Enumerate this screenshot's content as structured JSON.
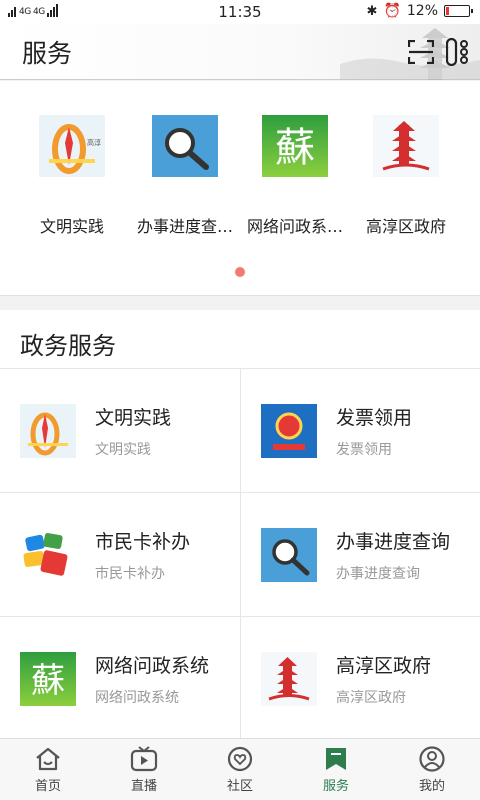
{
  "status": {
    "network": "4G 4G",
    "time": "11:35",
    "battery": "12%",
    "battery_fraction": 0.12
  },
  "header": {
    "title": "服务"
  },
  "banner": {
    "items": [
      {
        "label": "文明实践",
        "icon": "civilization-logo-icon"
      },
      {
        "label": "办事进度查…",
        "icon": "magnifier-icon"
      },
      {
        "label": "网络问政系…",
        "icon": "su-character-icon"
      },
      {
        "label": "高淳区政府",
        "icon": "pagoda-seal-icon"
      }
    ],
    "page_count": 1,
    "active_page": 1
  },
  "section": {
    "title": "政务服务",
    "items": [
      {
        "title": "文明实践",
        "sub": "文明实践",
        "icon": "civilization-logo-icon"
      },
      {
        "title": "发票领用",
        "sub": "发票领用",
        "icon": "tax-emblem-icon"
      },
      {
        "title": "市民卡补办",
        "sub": "市民卡补办",
        "icon": "citizen-card-icon"
      },
      {
        "title": "办事进度查询",
        "sub": "办事进度查询",
        "icon": "magnifier-icon"
      },
      {
        "title": "网络问政系统",
        "sub": "网络问政系统",
        "icon": "su-character-icon"
      },
      {
        "title": "高淳区政府",
        "sub": "高淳区政府",
        "icon": "pagoda-seal-icon"
      }
    ]
  },
  "tabs": [
    {
      "label": "首页",
      "icon": "home-icon",
      "active": false
    },
    {
      "label": "直播",
      "icon": "tv-play-icon",
      "active": false
    },
    {
      "label": "社区",
      "icon": "heart-bubble-icon",
      "active": false
    },
    {
      "label": "服务",
      "icon": "bookmark-icon",
      "active": true
    },
    {
      "label": "我的",
      "icon": "user-icon",
      "active": false
    }
  ],
  "colors": {
    "accent": "#2e7d4f",
    "dot": "#f07a73",
    "battery_low": "#ee3333"
  }
}
